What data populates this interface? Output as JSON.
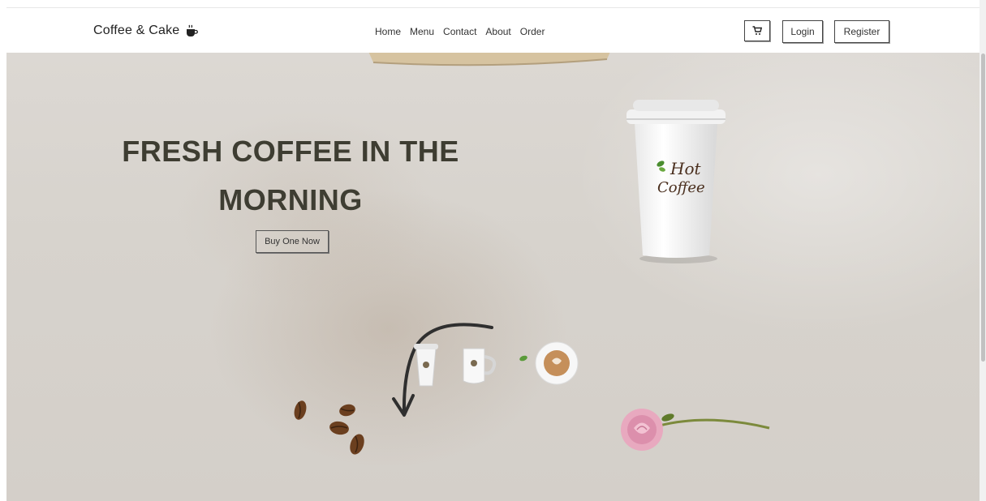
{
  "brand": {
    "name": "Coffee & Cake",
    "icon": "coffee-cup-icon"
  },
  "nav": {
    "links": [
      "Home",
      "Menu",
      "Contact",
      "About",
      "Order"
    ]
  },
  "actions": {
    "cart_icon": "cart-icon",
    "login": "Login",
    "register": "Register"
  },
  "hero": {
    "title_line1": "FRESH COFFEE IN THE",
    "title_line2": "MORNING",
    "cta": "Buy One Now",
    "cup_logo_line1": "Hot",
    "cup_logo_line2": "Coffee"
  },
  "colors": {
    "title": "#3e3d32",
    "background": "#d9d5cf",
    "border": "#444444"
  }
}
